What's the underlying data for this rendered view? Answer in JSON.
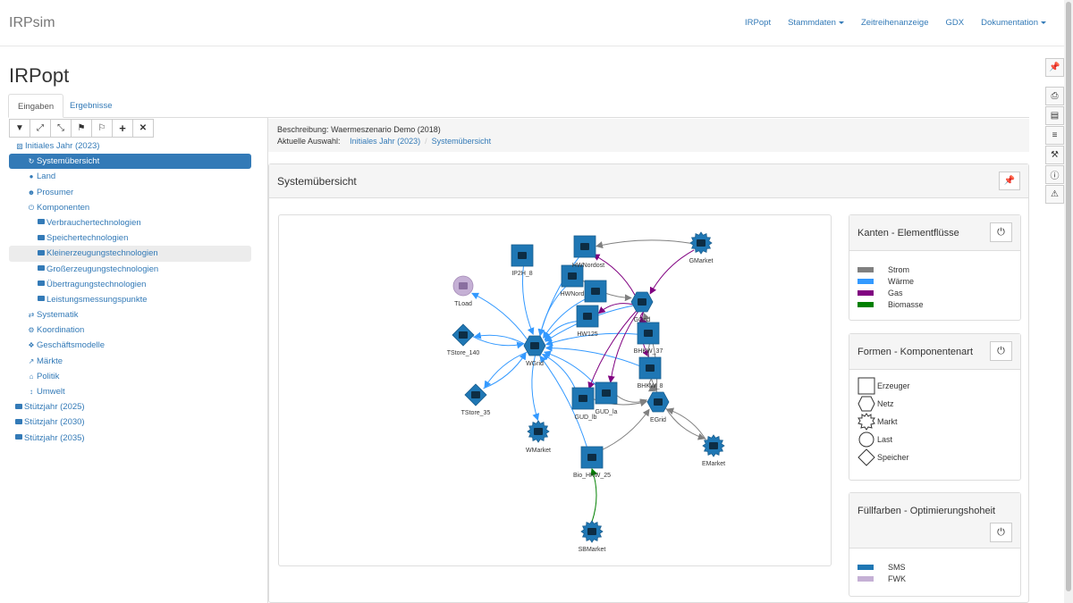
{
  "app": {
    "brand": "IRPsim",
    "nav": [
      {
        "label": "IRPopt",
        "dropdown": false
      },
      {
        "label": "Stammdaten",
        "dropdown": true
      },
      {
        "label": "Zeitreihenanzeige",
        "dropdown": false
      },
      {
        "label": "GDX",
        "dropdown": false
      },
      {
        "label": "Dokumentation",
        "dropdown": true
      }
    ]
  },
  "page": {
    "title": "IRPopt",
    "tabs": {
      "inputs": "Eingaben",
      "results": "Ergebnisse"
    }
  },
  "tree": {
    "toolbar": [
      "filter-icon",
      "expand-icon",
      "collapse-icon",
      "flag-icon",
      "flag-multi-icon",
      "plus-icon",
      "close-icon"
    ],
    "items": [
      {
        "label": "Initiales Jahr (2023)",
        "icon": "folder-open-icon",
        "level": 0
      },
      {
        "label": "Systemübersicht",
        "icon": "refresh-icon",
        "level": 1,
        "selected": true
      },
      {
        "label": "Land",
        "icon": "map-marker-icon",
        "level": 1
      },
      {
        "label": "Prosumer",
        "icon": "users-icon",
        "level": 1
      },
      {
        "label": "Komponenten",
        "icon": "power-icon",
        "level": 1
      },
      {
        "label": "Verbrauchertechnologien",
        "icon": "folder-icon",
        "level": 2
      },
      {
        "label": "Speichertechnologien",
        "icon": "folder-icon",
        "level": 2
      },
      {
        "label": "Kleinerzeugungstechnologien",
        "icon": "folder-icon",
        "level": 2,
        "hover": true
      },
      {
        "label": "Großerzeugungstechnologien",
        "icon": "folder-icon",
        "level": 2
      },
      {
        "label": "Übertragungstechnologien",
        "icon": "folder-icon",
        "level": 2
      },
      {
        "label": "Leistungsmessungspunkte",
        "icon": "folder-icon",
        "level": 2
      },
      {
        "label": "Systematik",
        "icon": "exchange-icon",
        "level": 1
      },
      {
        "label": "Koordination",
        "icon": "cogs-icon",
        "level": 1
      },
      {
        "label": "Geschäftsmodelle",
        "icon": "cubes-icon",
        "level": 1
      },
      {
        "label": "Märkte",
        "icon": "chart-line-icon",
        "level": 1
      },
      {
        "label": "Politik",
        "icon": "bank-icon",
        "level": 1
      },
      {
        "label": "Umwelt",
        "icon": "thermometer-icon",
        "level": 1
      },
      {
        "label": "Stützjahr (2025)",
        "icon": "folder-icon",
        "level": 0
      },
      {
        "label": "Stützjahr (2030)",
        "icon": "folder-icon",
        "level": 0
      },
      {
        "label": "Stützjahr (2035)",
        "icon": "folder-icon",
        "level": 0
      }
    ]
  },
  "description": {
    "label": "Beschreibung:",
    "value": "Waermeszenario Demo (2018)",
    "selection_label": "Aktuelle Auswahl:",
    "breadcrumb": [
      "Initiales Jahr (2023)",
      "Systemübersicht"
    ]
  },
  "panel": {
    "title": "Systemübersicht"
  },
  "legends": {
    "edges": {
      "title": "Kanten - Elementflüsse",
      "items": [
        {
          "label": "Strom",
          "color": "#808080"
        },
        {
          "label": "Wärme",
          "color": "#3399ff"
        },
        {
          "label": "Gas",
          "color": "#800080"
        },
        {
          "label": "Biomasse",
          "color": "#008000"
        }
      ]
    },
    "shapes": {
      "title": "Formen - Komponentenart",
      "items": [
        {
          "label": "Erzeuger",
          "shape": "square"
        },
        {
          "label": "Netz",
          "shape": "hexagon"
        },
        {
          "label": "Markt",
          "shape": "star"
        },
        {
          "label": "Last",
          "shape": "circle"
        },
        {
          "label": "Speicher",
          "shape": "diamond"
        }
      ]
    },
    "fills": {
      "title": "Füllfarben - Optimierungshoheit",
      "items": [
        {
          "label": "SMS",
          "color": "#1f77b4"
        },
        {
          "label": "FWK",
          "color": "#c5b0d5"
        }
      ]
    }
  },
  "graph": {
    "colors": {
      "sms": "#1f77b4",
      "fwk": "#c5b0d5",
      "strom": "#808080",
      "waerme": "#3399ff",
      "gas": "#800080",
      "biomasse": "#008000"
    },
    "labels": {
      "ip2h": "IP2H_8",
      "hwnordost": "HWNordost",
      "hwnord": "HWNord",
      "hw125": "HW125",
      "tload": "TLoad",
      "gmarket": "GMarket",
      "ggrid": "GGrid",
      "bhkw37": "BHKW_37",
      "bhkw8": "BHKW_8",
      "tstore140": "TStore_140",
      "wgrid": "WGrid",
      "tstore35": "TStore_35",
      "gudla": "GUD_la",
      "gudlb": "GUD_lb",
      "egrid": "EGrid",
      "wmarket": "WMarket",
      "biohkw25": "Bio_HKW_25",
      "emarket": "EMarket",
      "sbmarket": "SBMarket"
    }
  }
}
